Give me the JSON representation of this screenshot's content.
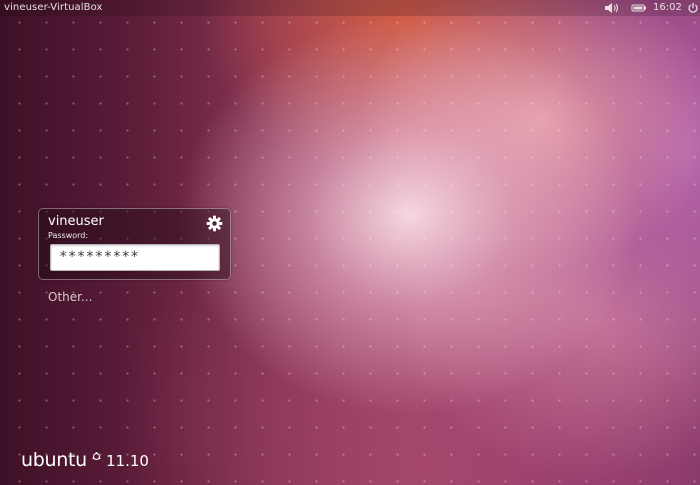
{
  "top_panel": {
    "hostname": "vineuser-VirtualBox",
    "clock": "16:02",
    "icons": [
      "volume-icon",
      "battery-icon",
      "session-icon"
    ]
  },
  "login": {
    "username": "vineuser",
    "password_label": "Password:",
    "password_value": "*********",
    "other_label": "Other..."
  },
  "branding": {
    "wordmark": "ubuntu",
    "version": "11.10"
  },
  "colors": {
    "accent": "#e95420",
    "text": "#ffffff"
  }
}
